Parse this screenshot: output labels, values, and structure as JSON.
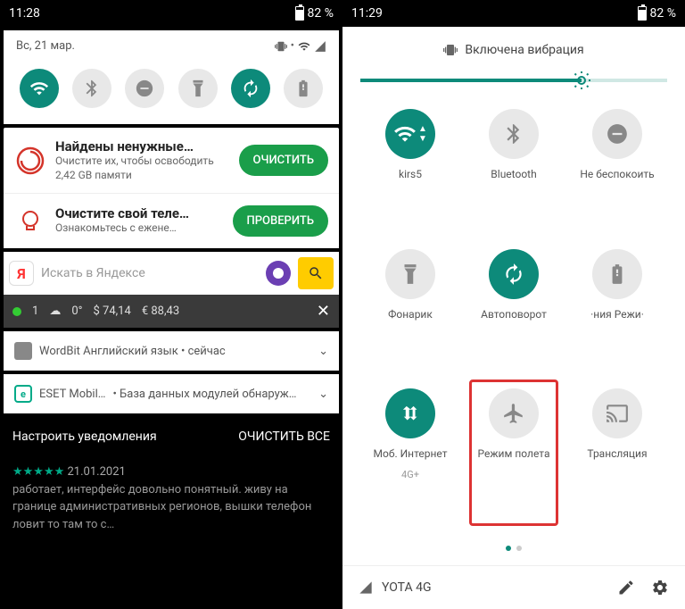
{
  "left": {
    "time": "11:28",
    "battery": "82 %",
    "date": "Вс, 21 мар.",
    "notif1": {
      "title": "Найдены ненужные…",
      "sub": "Очистите их, чтобы освободить 2,42 GB памяти",
      "btn": "ОЧИСТИТЬ"
    },
    "notif2": {
      "title": "Очистите свой теле…",
      "sub": "Ознакомьтесь с ежене…",
      "btn": "ПРОВЕРИТЬ"
    },
    "search": {
      "placeholder": "Искать в Яндексе"
    },
    "weather": {
      "count": "1",
      "temp": "0°",
      "usd": "$ 74,14",
      "eur": "€ 88,43"
    },
    "row1": "WordBit Английский язык • сейчас",
    "row2a": "ESET Mobil…",
    "row2b": "• База данных модулей обнаруж…",
    "footer": {
      "left": "Настроить уведомления",
      "right": "ОЧИСТИТЬ ВСЕ"
    },
    "bg": "работает, интерфейс довольно понятный. живу на границе административных регионов, вышки телефон ловит то там то с…",
    "bgdate": "21.01.2021"
  },
  "right": {
    "time": "11:29",
    "battery": "82 %",
    "vib": "Включена вибрация",
    "tiles": [
      {
        "label": "kirs5",
        "active": true
      },
      {
        "label": "Bluetooth",
        "active": false
      },
      {
        "label": "Не беспокоить",
        "active": false
      },
      {
        "label": "Фонарик",
        "active": false
      },
      {
        "label": "Автоповорот",
        "active": true
      },
      {
        "label": "·ния     Режи·",
        "active": false
      },
      {
        "label": "Моб. Интернет",
        "sub": "4G+",
        "active": true
      },
      {
        "label": "Режим полета",
        "active": false,
        "highlight": true
      },
      {
        "label": "Трансляция",
        "active": false
      }
    ],
    "carrier": "YOTA 4G"
  }
}
